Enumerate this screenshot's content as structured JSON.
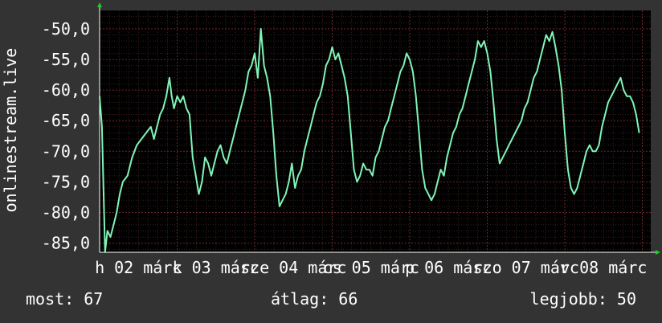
{
  "chart_data": {
    "type": "line",
    "ylabel": "onlinestream.live",
    "ylim": [
      -86.5,
      -47.0
    ],
    "y_ticks": [
      "-50,0",
      "-55,0",
      "-60,0",
      "-65,0",
      "-70,0",
      "-75,0",
      "-80,0",
      "-85,0"
    ],
    "y_tick_values": [
      -50,
      -55,
      -60,
      -65,
      -70,
      -75,
      -80,
      -85
    ],
    "x_tick_labels": [
      "h 02 márc",
      "k 03 márc",
      "sze 04 márc",
      "cs 05 márc",
      "p 06 márc",
      "szo 07 márc",
      "v 08 márc"
    ],
    "xlim": [
      0,
      7.4
    ],
    "grid": true,
    "line_color": "#7ff5b8",
    "series": [
      {
        "values": [
          [
            0.0,
            -61
          ],
          [
            0.03,
            -66
          ],
          [
            0.05,
            -76
          ],
          [
            0.07,
            -86.5
          ],
          [
            0.1,
            -83
          ],
          [
            0.14,
            -84
          ],
          [
            0.18,
            -82
          ],
          [
            0.22,
            -80
          ],
          [
            0.26,
            -77
          ],
          [
            0.3,
            -75
          ],
          [
            0.36,
            -74
          ],
          [
            0.42,
            -71
          ],
          [
            0.48,
            -69
          ],
          [
            0.54,
            -68
          ],
          [
            0.6,
            -67
          ],
          [
            0.66,
            -66
          ],
          [
            0.7,
            -68
          ],
          [
            0.74,
            -66
          ],
          [
            0.78,
            -64
          ],
          [
            0.82,
            -63
          ],
          [
            0.86,
            -61
          ],
          [
            0.9,
            -58
          ],
          [
            0.93,
            -61
          ],
          [
            0.96,
            -63
          ],
          [
            1.0,
            -61
          ],
          [
            1.04,
            -62
          ],
          [
            1.08,
            -61
          ],
          [
            1.12,
            -63
          ],
          [
            1.16,
            -64
          ],
          [
            1.2,
            -71
          ],
          [
            1.24,
            -74
          ],
          [
            1.28,
            -77
          ],
          [
            1.32,
            -75
          ],
          [
            1.36,
            -71
          ],
          [
            1.4,
            -72
          ],
          [
            1.44,
            -74
          ],
          [
            1.48,
            -72
          ],
          [
            1.52,
            -70
          ],
          [
            1.56,
            -69
          ],
          [
            1.6,
            -71
          ],
          [
            1.64,
            -72
          ],
          [
            1.68,
            -70
          ],
          [
            1.72,
            -68
          ],
          [
            1.76,
            -66
          ],
          [
            1.8,
            -64
          ],
          [
            1.84,
            -62
          ],
          [
            1.88,
            -60
          ],
          [
            1.92,
            -57
          ],
          [
            1.96,
            -56
          ],
          [
            2.0,
            -54
          ],
          [
            2.04,
            -58
          ],
          [
            2.08,
            -50
          ],
          [
            2.12,
            -56
          ],
          [
            2.16,
            -58
          ],
          [
            2.2,
            -61
          ],
          [
            2.24,
            -67
          ],
          [
            2.28,
            -74
          ],
          [
            2.32,
            -79
          ],
          [
            2.36,
            -78
          ],
          [
            2.4,
            -77
          ],
          [
            2.44,
            -75
          ],
          [
            2.48,
            -72
          ],
          [
            2.52,
            -76
          ],
          [
            2.56,
            -74
          ],
          [
            2.6,
            -73
          ],
          [
            2.64,
            -70
          ],
          [
            2.68,
            -68
          ],
          [
            2.72,
            -66
          ],
          [
            2.76,
            -64
          ],
          [
            2.8,
            -62
          ],
          [
            2.84,
            -61
          ],
          [
            2.88,
            -59
          ],
          [
            2.92,
            -56
          ],
          [
            2.96,
            -55
          ],
          [
            3.0,
            -53
          ],
          [
            3.04,
            -55
          ],
          [
            3.08,
            -54
          ],
          [
            3.12,
            -56
          ],
          [
            3.16,
            -58
          ],
          [
            3.2,
            -61
          ],
          [
            3.24,
            -67
          ],
          [
            3.28,
            -73
          ],
          [
            3.32,
            -75
          ],
          [
            3.36,
            -74
          ],
          [
            3.4,
            -72
          ],
          [
            3.44,
            -73
          ],
          [
            3.48,
            -73
          ],
          [
            3.52,
            -74
          ],
          [
            3.56,
            -71
          ],
          [
            3.6,
            -70
          ],
          [
            3.64,
            -68
          ],
          [
            3.68,
            -66
          ],
          [
            3.72,
            -65
          ],
          [
            3.76,
            -63
          ],
          [
            3.8,
            -61
          ],
          [
            3.84,
            -59
          ],
          [
            3.88,
            -57
          ],
          [
            3.92,
            -56
          ],
          [
            3.96,
            -54
          ],
          [
            4.0,
            -55
          ],
          [
            4.04,
            -57
          ],
          [
            4.08,
            -61
          ],
          [
            4.12,
            -67
          ],
          [
            4.16,
            -73
          ],
          [
            4.2,
            -76
          ],
          [
            4.24,
            -77
          ],
          [
            4.28,
            -78
          ],
          [
            4.32,
            -77
          ],
          [
            4.36,
            -75
          ],
          [
            4.4,
            -73
          ],
          [
            4.44,
            -74
          ],
          [
            4.48,
            -71
          ],
          [
            4.52,
            -69
          ],
          [
            4.56,
            -67
          ],
          [
            4.6,
            -66
          ],
          [
            4.64,
            -64
          ],
          [
            4.68,
            -63
          ],
          [
            4.72,
            -61
          ],
          [
            4.76,
            -59
          ],
          [
            4.8,
            -57
          ],
          [
            4.84,
            -55
          ],
          [
            4.88,
            -52
          ],
          [
            4.92,
            -53
          ],
          [
            4.96,
            -52
          ],
          [
            5.0,
            -54
          ],
          [
            5.04,
            -57
          ],
          [
            5.08,
            -62
          ],
          [
            5.12,
            -68
          ],
          [
            5.16,
            -72
          ],
          [
            5.2,
            -71
          ],
          [
            5.24,
            -70
          ],
          [
            5.28,
            -69
          ],
          [
            5.32,
            -68
          ],
          [
            5.36,
            -67
          ],
          [
            5.4,
            -66
          ],
          [
            5.44,
            -65
          ],
          [
            5.48,
            -63
          ],
          [
            5.52,
            -62
          ],
          [
            5.56,
            -60
          ],
          [
            5.6,
            -58
          ],
          [
            5.64,
            -57
          ],
          [
            5.68,
            -55
          ],
          [
            5.72,
            -53
          ],
          [
            5.76,
            -51
          ],
          [
            5.8,
            -52
          ],
          [
            5.84,
            -50.5
          ],
          [
            5.88,
            -53
          ],
          [
            5.92,
            -56
          ],
          [
            5.96,
            -60
          ],
          [
            6.0,
            -67
          ],
          [
            6.04,
            -73
          ],
          [
            6.08,
            -76
          ],
          [
            6.12,
            -77
          ],
          [
            6.16,
            -76
          ],
          [
            6.2,
            -74
          ],
          [
            6.24,
            -72
          ],
          [
            6.28,
            -70
          ],
          [
            6.32,
            -69
          ],
          [
            6.36,
            -70
          ],
          [
            6.4,
            -70
          ],
          [
            6.44,
            -69
          ],
          [
            6.48,
            -66
          ],
          [
            6.52,
            -64
          ],
          [
            6.56,
            -62
          ],
          [
            6.6,
            -61
          ],
          [
            6.64,
            -60
          ],
          [
            6.68,
            -59
          ],
          [
            6.72,
            -58
          ],
          [
            6.76,
            -60
          ],
          [
            6.8,
            -61
          ],
          [
            6.84,
            -61
          ],
          [
            6.88,
            -62
          ],
          [
            6.92,
            -64
          ],
          [
            6.96,
            -67
          ]
        ]
      }
    ]
  },
  "footer": {
    "now_label": "most: 67",
    "avg_label": "átlag: 66",
    "best_label": "legjobb: 50"
  }
}
